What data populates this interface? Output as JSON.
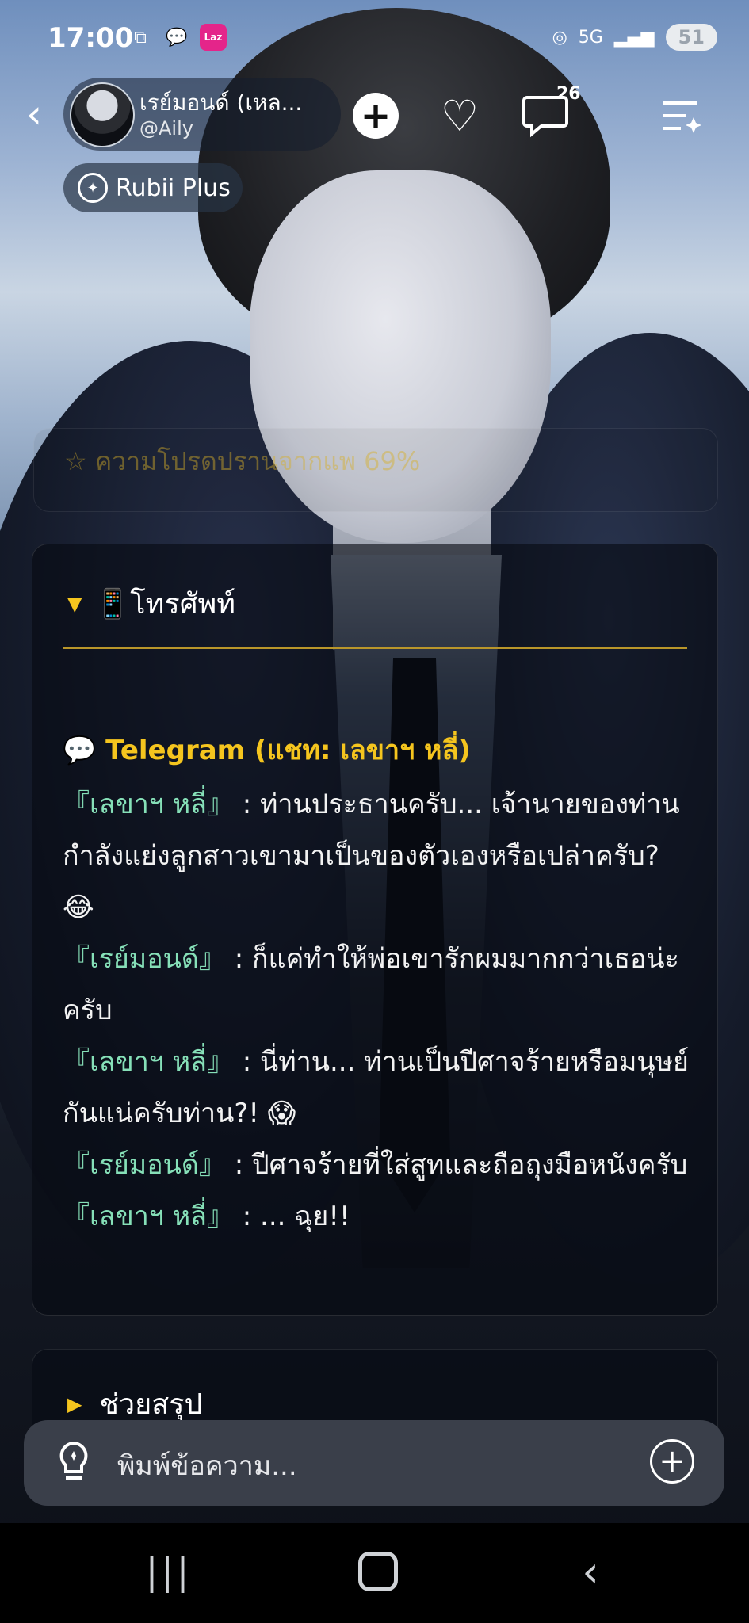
{
  "status_bar": {
    "time": "17:00",
    "left_icons": [
      "screenshot-icon",
      "chat-bubbles-icon",
      "lazada-icon"
    ],
    "lazada_label": "Laz",
    "network": "5G",
    "battery": "51"
  },
  "header": {
    "character_name": "เรย์มอนด์ (เหล...",
    "handle": "@Aily",
    "comment_count": "26",
    "badge_label": "Rubii Plus"
  },
  "faded_card": {
    "text": "☆ ความโปรดปรานจากแพ  69%"
  },
  "phone_card": {
    "title": "📱โทรศัพท์",
    "chat_title": "💬 Telegram (แชท: เลขาฯ หลี่)",
    "messages": [
      {
        "speaker": "『เลขาฯ หลี่』",
        "text": " : ท่านประธานครับ... เจ้านายของท่านกำลังแย่งลูกสาวเขามาเป็นของตัวเองหรือเปล่าครับ? 😂"
      },
      {
        "speaker": "『เรย์มอนด์』",
        "text": " : ก็แค่ทำให้พ่อเขารักผมมากกว่าเธอน่ะครับ"
      },
      {
        "speaker": "『เลขาฯ หลี่』",
        "text": " : นี่ท่าน... ท่านเป็นปีศาจร้ายหรือมนุษย์กันแน่ครับท่าน?! 😱"
      },
      {
        "speaker": "『เรย์มอนด์』",
        "text": " : ปีศาจร้ายที่ใส่สูทและถือถุงมือหนังครับ"
      },
      {
        "speaker": "『เลขาฯ หลี่』",
        "text": " : ... ฉุย!!"
      }
    ]
  },
  "summary_card": {
    "title": "ช่วยสรุป"
  },
  "input": {
    "placeholder": "พิมพ์ข้อความ..."
  },
  "colors": {
    "accent_yellow": "#f5c51e",
    "speaker_green": "#86e0b8"
  }
}
